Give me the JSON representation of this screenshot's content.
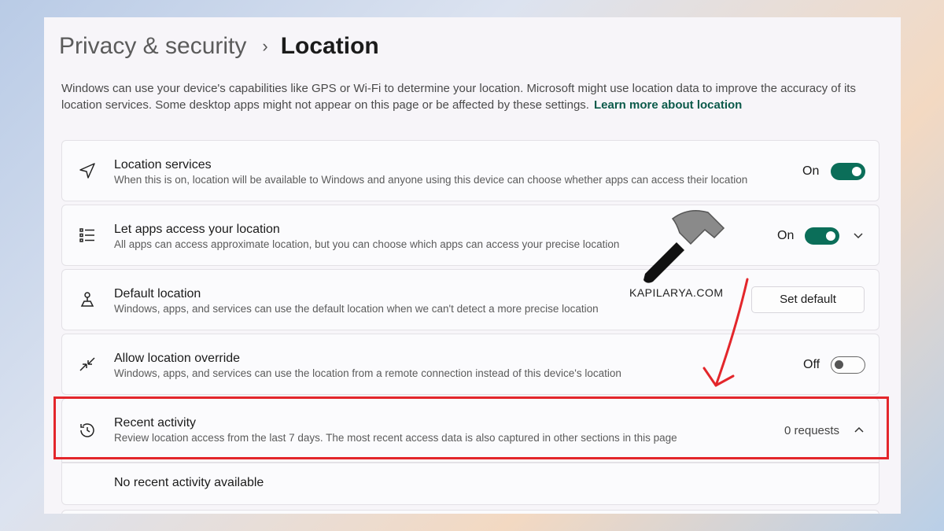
{
  "breadcrumb": {
    "parent": "Privacy & security",
    "separator": ">",
    "current": "Location"
  },
  "description": {
    "text": "Windows can use your device's capabilities like GPS or Wi-Fi to determine your location. Microsoft might use location data to improve the accuracy of its location services. Some desktop apps might not appear on this page or be affected by these settings.",
    "link": "Learn more about location"
  },
  "settings": {
    "location_services": {
      "title": "Location services",
      "subtitle": "When this is on, location will be available to Windows and anyone using this device can choose whether apps can access their location",
      "state": "On",
      "icon": "navigation-arrow-icon"
    },
    "let_apps": {
      "title": "Let apps access your location",
      "subtitle": "All apps can access approximate location, but you can choose which apps can access your precise location",
      "state": "On",
      "icon": "list-icon"
    },
    "default_location": {
      "title": "Default location",
      "subtitle": "Windows, apps, and services can use the default location when we can't detect a more precise location",
      "button": "Set default",
      "icon": "location-pin-icon"
    },
    "override": {
      "title": "Allow location override",
      "subtitle": "Windows, apps, and services can use the location from a remote connection instead of this device's location",
      "state": "Off",
      "icon": "remote-arrows-icon"
    },
    "recent_activity": {
      "title": "Recent activity",
      "subtitle": "Review location access from the last 7 days. The most recent access data is also captured in other sections in this page",
      "count": "0 requests",
      "icon": "history-icon"
    },
    "no_activity": "No recent activity available"
  },
  "watermark": {
    "text": "KAPILARYA.COM"
  },
  "colors": {
    "accent": "#0b6e59",
    "highlight": "#e3262b"
  }
}
